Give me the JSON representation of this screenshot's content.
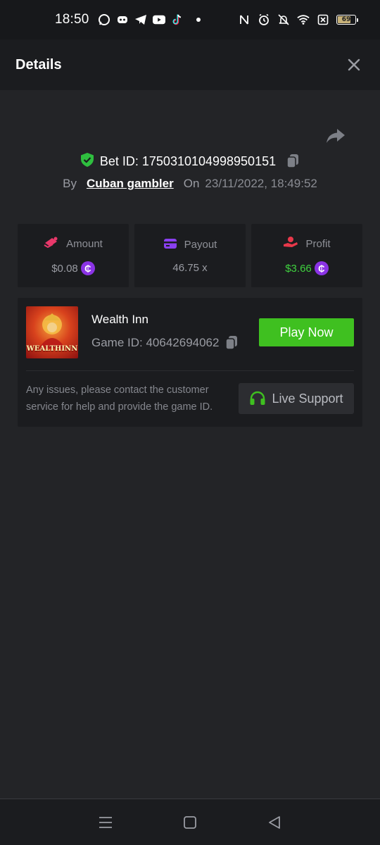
{
  "status_bar": {
    "time": "18:50",
    "battery_level": "69",
    "app_icons": [
      "whatsapp-icon",
      "discord-icon",
      "telegram-icon",
      "youtube-icon",
      "tiktok-icon"
    ],
    "system_icons": [
      "nfc-icon",
      "alarm-icon",
      "mute-icon",
      "wifi-icon",
      "data-off-icon",
      "battery-icon"
    ]
  },
  "header": {
    "title": "Details",
    "close_icon": "close-icon"
  },
  "bet": {
    "id_label": "Bet ID: 1750310104998950151",
    "by_label": "By",
    "username": "Cuban gambler",
    "on_label": "On",
    "date": "23/11/2022, 18:49:52"
  },
  "stats": {
    "amount_label": "Amount",
    "amount_value": "$0.08",
    "payout_label": "Payout",
    "payout_value": "46.75 x",
    "profit_label": "Profit",
    "profit_value": "$3.66",
    "coin_symbol": "₵"
  },
  "game": {
    "name": "Wealth Inn",
    "thumb_caption": "WEALTHINN",
    "game_id_label": "Game ID: 40642694062",
    "play_button": "Play Now",
    "support_text": "Any issues, please contact the customer service for help and provide the game ID.",
    "support_button": "Live Support"
  },
  "colors": {
    "background": "#232427",
    "card": "#1b1c1f",
    "accent_green": "#3fc020",
    "profit_green": "#3fd13f",
    "coin_purple": "#8b33e6",
    "amount_icon": "#e8386a",
    "payout_icon": "#8a3ff0",
    "profit_icon": "#e8384a"
  }
}
